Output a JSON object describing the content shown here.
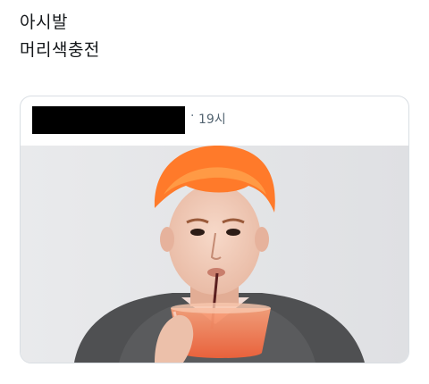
{
  "post": {
    "lines": [
      "아시발",
      "머리색충전"
    ]
  },
  "quoted_post": {
    "author_name_redacted": true,
    "separator": "·",
    "time": "19시"
  },
  "colors": {
    "redaction": "#000000",
    "card_border": "#d9dee3",
    "muted_text": "#536471",
    "hair": "#ff7a2a",
    "drink": "#f47a4c"
  }
}
